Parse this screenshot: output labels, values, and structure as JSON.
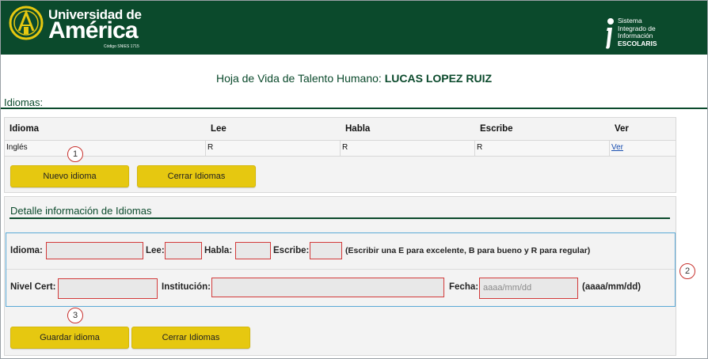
{
  "header": {
    "brand_top": "Universidad de",
    "brand_main": "América",
    "brand_sub": "Código SNIES 1715",
    "sis_lines": [
      "Sistema",
      "Integrado de",
      "Información"
    ],
    "sis_strong": "ESCOLARIS",
    "bg_color": "#0b4a2c"
  },
  "page": {
    "title_prefix": "Hoja de Vida de Talento Humano:",
    "title_name": "LUCAS LOPEZ RUIZ",
    "section_label": "Idiomas:"
  },
  "table": {
    "headers": [
      "Idioma",
      "Lee",
      "Habla",
      "Escribe",
      "Ver"
    ],
    "rows": [
      {
        "idioma": "Inglés",
        "lee": "R",
        "habla": "R",
        "escribe": "R",
        "ver": "Ver"
      }
    ]
  },
  "buttons": {
    "nuevo": "Nuevo idioma",
    "cerrar_top": "Cerrar Idiomas",
    "guardar": "Guardar idioma",
    "cerrar_bottom": "Cerrar Idiomas",
    "accent": "#e6c810"
  },
  "detail": {
    "title": "Detalle información de Idiomas",
    "labels": {
      "idioma": "Idioma:",
      "lee": "Lee:",
      "habla": "Habla:",
      "escribe": "Escribe:",
      "hint": "(Escribir una E para excelente, B para bueno y R para regular)",
      "nivel": "Nivel Cert:",
      "institucion": "Institución:",
      "fecha": "Fecha:",
      "fecha_hint": "(aaaa/mm/dd)"
    },
    "fecha_placeholder": "aaaa/mm/dd"
  },
  "callouts": [
    "1",
    "2",
    "3"
  ],
  "colors": {
    "field_border": "#d23a3a",
    "form_border": "#5aa9d6",
    "callout": "#c8322e"
  }
}
